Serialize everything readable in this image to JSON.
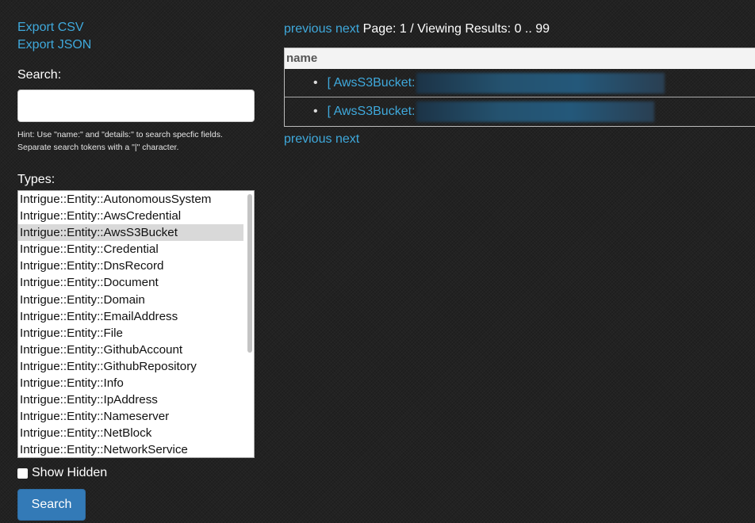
{
  "sidebar": {
    "export_csv": "Export CSV",
    "export_json": "Export JSON",
    "search_label": "Search:",
    "search_value": "",
    "hint": "Hint: Use \"name:\" and \"details:\" to search specfic fields. Separate search tokens with a \"|\" character.",
    "types_label": "Types:",
    "types": [
      "Intrigue::Entity::AutonomousSystem",
      "Intrigue::Entity::AwsCredential",
      "Intrigue::Entity::AwsS3Bucket",
      "Intrigue::Entity::Credential",
      "Intrigue::Entity::DnsRecord",
      "Intrigue::Entity::Document",
      "Intrigue::Entity::Domain",
      "Intrigue::Entity::EmailAddress",
      "Intrigue::Entity::File",
      "Intrigue::Entity::GithubAccount",
      "Intrigue::Entity::GithubRepository",
      "Intrigue::Entity::Info",
      "Intrigue::Entity::IpAddress",
      "Intrigue::Entity::Nameserver",
      "Intrigue::Entity::NetBlock",
      "Intrigue::Entity::NetworkService"
    ],
    "selected_type": "Intrigue::Entity::AwsS3Bucket",
    "show_hidden_label": "Show Hidden",
    "search_button": "Search"
  },
  "main": {
    "pager": {
      "previous": "previous",
      "next": "next",
      "status": "Page: 1 / Viewing Results: 0 .. 99"
    },
    "table_header": "name",
    "rows": [
      {
        "bullet": "•",
        "label": "[ AwsS3Bucket:"
      },
      {
        "bullet": "•",
        "label": "[ AwsS3Bucket:"
      }
    ]
  },
  "colors": {
    "background": "#222222",
    "link": "#3fa9dc",
    "button": "#337ab7",
    "selected_option": "#d9d9d9"
  }
}
